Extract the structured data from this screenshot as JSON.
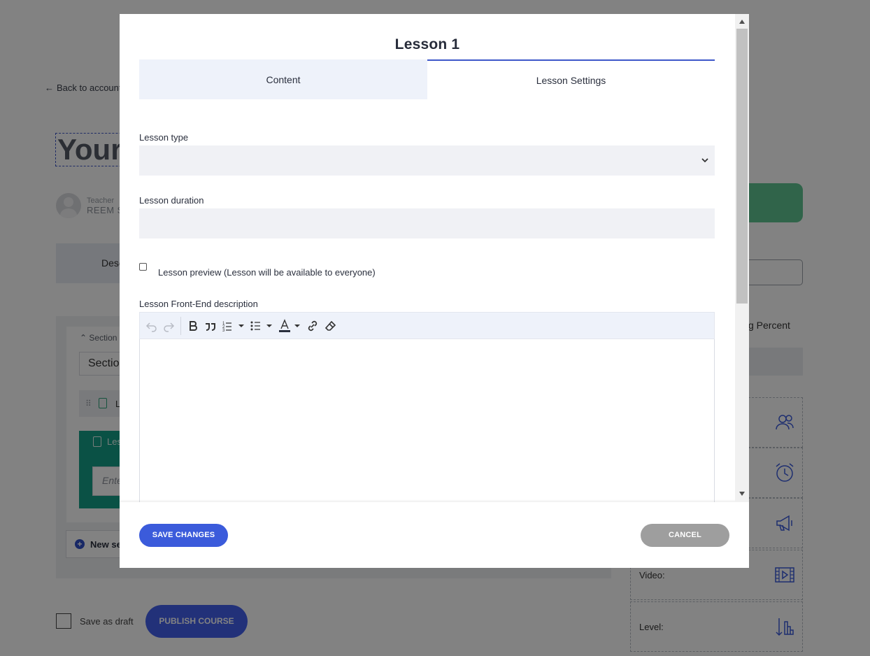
{
  "background": {
    "back_link": "Back to account",
    "course_title": "Your",
    "teacher_label": "Teacher",
    "teacher_name": "REEM S",
    "desc_tab": "Desc",
    "section_label": "Section",
    "section_input": "Sectio",
    "lesson_row_label": "L",
    "lesson_active_label": "Les",
    "lesson_active_placeholder": "Ente",
    "new_section": "New sec",
    "save_as_draft": "Save as draft",
    "publish_course": "PUBLISH COURSE",
    "percent_text": "g Percent",
    "video_label": "Video:",
    "level_label": "Level:"
  },
  "modal": {
    "title": "Lesson 1",
    "tabs": [
      {
        "label": "Content"
      },
      {
        "label": "Lesson Settings"
      }
    ],
    "lesson_type_label": "Lesson type",
    "lesson_type_value": "",
    "lesson_duration_label": "Lesson duration",
    "lesson_duration_value": "",
    "lesson_preview_label": "Lesson preview (Lesson will be available to everyone)",
    "description_label": "Lesson Front-End description",
    "save_button": "SAVE CHANGES",
    "cancel_button": "CANCEL"
  },
  "colors": {
    "primary": "#3b5bdb",
    "cancel": "#9e9e9e",
    "accent_green": "#15a087"
  }
}
